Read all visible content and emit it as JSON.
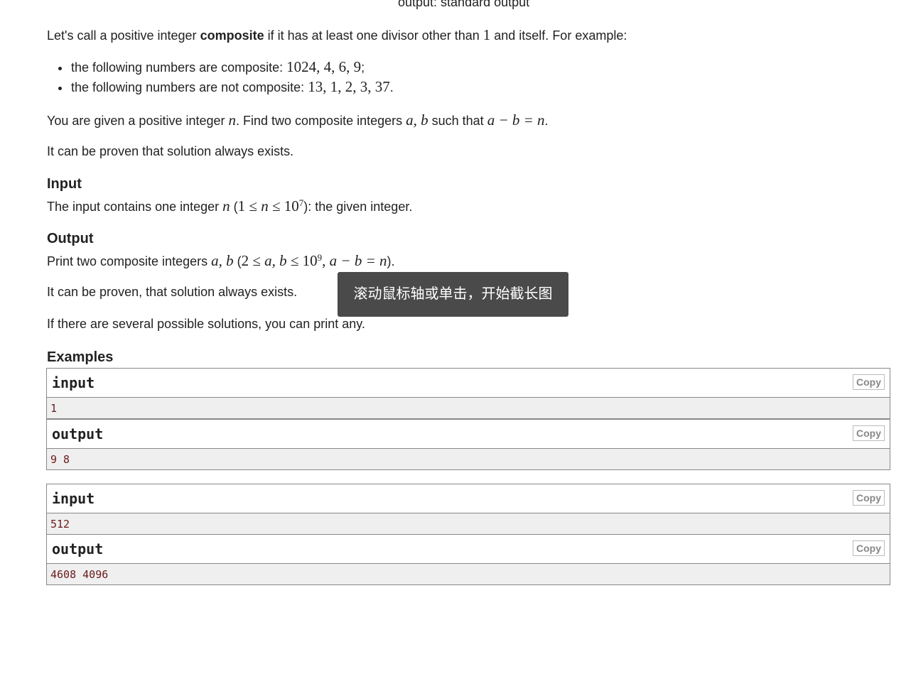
{
  "header": {
    "output_line": "output: standard output"
  },
  "statement": {
    "p1": {
      "a": "Let's call a positive integer ",
      "b": "composite",
      "c": " if it has at least one divisor other than ",
      "d": "1",
      "e": " and itself. For example:"
    },
    "bullets": [
      {
        "text": "the following numbers are composite: ",
        "math": "1024, 4, 6, 9",
        "end": ";"
      },
      {
        "text": "the following numbers are not composite: ",
        "math": "13, 1, 2, 3, 37",
        "end": "."
      }
    ],
    "p2": {
      "a": "You are given a positive integer ",
      "n": "n",
      "b": ". Find two composite integers ",
      "ab": "a, b",
      "c": " such that ",
      "eq": "a − b = n",
      "d": "."
    },
    "p3": "It can be proven that solution always exists."
  },
  "input_section": {
    "title": "Input",
    "a": "The input contains one integer ",
    "n": "n",
    "b": " (",
    "m1": "1 ≤ ",
    "m2": "n",
    "m3": " ≤ 10",
    "sup": "7",
    "c": "): the given integer."
  },
  "output_section": {
    "title": "Output",
    "a": "Print two composite integers ",
    "ab": "a, b",
    "b": " (",
    "m1": "2 ≤ ",
    "m2": "a, b",
    "m3": " ≤ 10",
    "sup": "9",
    "m4": ", ",
    "m5": "a − b = n",
    "c": ").",
    "p2": "It can be proven, that solution always exists.",
    "p3": "If there are several possible solutions, you can print any."
  },
  "examples": {
    "title": "Examples",
    "copy_label": "Copy",
    "items": [
      {
        "input_label": "input",
        "input": "1",
        "output_label": "output",
        "output": "9 8"
      },
      {
        "input_label": "input",
        "input": "512",
        "output_label": "output",
        "output": "4608 4096"
      }
    ]
  },
  "tooltip": "滚动鼠标轴或单击，开始截长图"
}
